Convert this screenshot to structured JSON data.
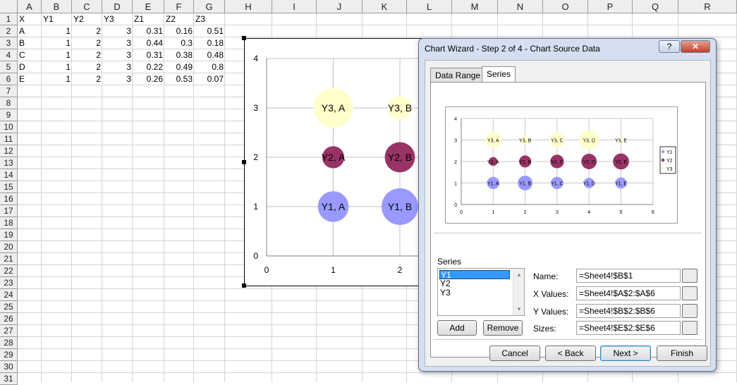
{
  "spreadsheet": {
    "columns": [
      "A",
      "B",
      "C",
      "D",
      "E",
      "F",
      "G",
      "H",
      "I",
      "J",
      "K",
      "L",
      "M",
      "N",
      "O",
      "P",
      "Q",
      "R"
    ],
    "rows": [
      "1",
      "2",
      "3",
      "4",
      "5",
      "6",
      "7",
      "8",
      "9",
      "10",
      "11",
      "12",
      "13",
      "14",
      "15",
      "16",
      "17",
      "18",
      "19",
      "20",
      "21",
      "22",
      "23",
      "24",
      "25",
      "26",
      "27",
      "28",
      "29",
      "30",
      "31"
    ],
    "header_row": [
      "X",
      "Y1",
      "Y2",
      "Y3",
      "Z1",
      "Z2",
      "Z3"
    ],
    "data_rows": [
      [
        "A",
        "1",
        "2",
        "3",
        "0.31",
        "0.16",
        "0.51"
      ],
      [
        "B",
        "1",
        "2",
        "3",
        "0.44",
        "0.3",
        "0.18"
      ],
      [
        "C",
        "1",
        "2",
        "3",
        "0.31",
        "0.38",
        "0.48"
      ],
      [
        "D",
        "1",
        "2",
        "3",
        "0.22",
        "0.49",
        "0.8"
      ],
      [
        "E",
        "1",
        "2",
        "3",
        "0.26",
        "0.53",
        "0.07"
      ]
    ]
  },
  "main_chart": {
    "y_ticks": [
      "0",
      "1",
      "2",
      "3",
      "4"
    ],
    "x_ticks": [
      "0",
      "1",
      "2"
    ],
    "bubble_labels": [
      "Y3, A",
      "Y3, B",
      "Y2, A",
      "Y2, B",
      "Y1, A",
      "Y1, B"
    ]
  },
  "dialog": {
    "title": "Chart Wizard - Step 2 of 4 - Chart Source Data",
    "help_glyph": "?",
    "close_glyph": "✕",
    "tabs": [
      "Data Range",
      "Series"
    ],
    "series_label": "Series",
    "series_list": [
      "Y1",
      "Y2",
      "Y3"
    ],
    "name_label": "Name:",
    "xvalues_label": "X Values:",
    "yvalues_label": "Y Values:",
    "sizes_label": "Sizes:",
    "name_value": "=Sheet4!$B$1",
    "xvalues_value": "=Sheet4!$A$2:$A$6",
    "yvalues_value": "=Sheet4!$B$2:$B$6",
    "sizes_value": "=Sheet4!$E$2:$E$6",
    "add_label": "Add",
    "remove_label": "Remove",
    "cancel_label": "Cancel",
    "back_label": "< Back",
    "next_label": "Next >",
    "finish_label": "Finish",
    "preview": {
      "y_ticks": [
        "0",
        "1",
        "2",
        "3",
        "4"
      ],
      "x_ticks": [
        "0",
        "1",
        "2",
        "3",
        "4",
        "5",
        "6"
      ],
      "legend": [
        "Y1",
        "Y2",
        "Y3"
      ],
      "bubble_labels": [
        "Y3, A",
        "Y3, B",
        "Y3, C",
        "Y3, D",
        "Y3, E",
        "Y2, A",
        "Y2, B",
        "Y2, C",
        "Y2, D",
        "Y2, E",
        "Y1, A",
        "Y1, B",
        "Y1, C",
        "Y1, D",
        "Y1, E"
      ]
    }
  },
  "colors": {
    "y1": "#9999ff",
    "y2": "#993366",
    "y3": "#ffffcc",
    "selection": "#3399ff"
  },
  "chart_data": {
    "type": "scatter",
    "x": [
      1,
      2,
      3,
      4,
      5
    ],
    "x_categories": [
      "A",
      "B",
      "C",
      "D",
      "E"
    ],
    "series": [
      {
        "name": "Y1",
        "values": [
          1,
          1,
          1,
          1,
          1
        ],
        "sizes": [
          0.31,
          0.44,
          0.31,
          0.22,
          0.26
        ]
      },
      {
        "name": "Y2",
        "values": [
          2,
          2,
          2,
          2,
          2
        ],
        "sizes": [
          0.16,
          0.3,
          0.38,
          0.49,
          0.53
        ]
      },
      {
        "name": "Y3",
        "values": [
          3,
          3,
          3,
          3,
          3
        ],
        "sizes": [
          0.51,
          0.18,
          0.48,
          0.8,
          0.07
        ]
      }
    ],
    "xlim": [
      0,
      6
    ],
    "ylim": [
      0,
      4
    ],
    "grid": true,
    "legend": "right"
  }
}
